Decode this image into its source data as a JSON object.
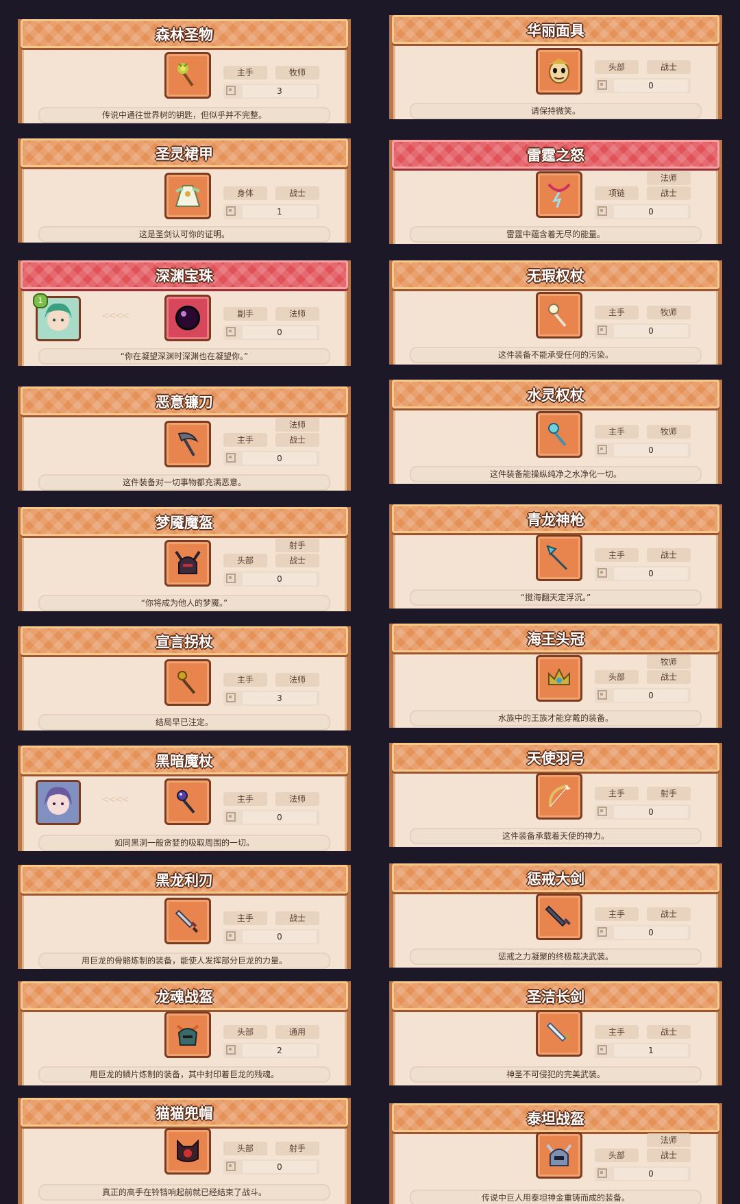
{
  "left": [
    {
      "title": "森林圣物",
      "banner": "orange",
      "icon": "golden-scepter-icon",
      "tags": [
        "主手",
        "牧师"
      ],
      "extra_tag": null,
      "level": "3",
      "desc": "传说中通往世界树的钥匙，但似乎并不完整。"
    },
    {
      "title": "圣灵裙甲",
      "banner": "orange",
      "icon": "holy-dress-icon",
      "tags": [
        "身体",
        "战士"
      ],
      "extra_tag": null,
      "level": "1",
      "desc": "这是圣剑认可你的证明。"
    },
    {
      "title": "深渊宝珠",
      "banner": "red",
      "icon": "abyss-orb-icon",
      "tags": [
        "副手",
        "法师"
      ],
      "extra_tag": null,
      "level": "0",
      "desc": "“你在凝望深渊时深渊也在凝望你。”",
      "portrait": "green-hair-girl-portrait",
      "portrait_badge": "1"
    },
    {
      "title": "恶意镰刀",
      "banner": "orange",
      "icon": "scythe-icon",
      "tags": [
        "主手",
        "战士"
      ],
      "extra_tag": "法师",
      "level": "0",
      "desc": "这件装备对一切事物都充满恶意。"
    },
    {
      "title": "梦魇魔盔",
      "banner": "orange",
      "icon": "horned-helmet-icon",
      "tags": [
        "头部",
        "战士"
      ],
      "extra_tag": "射手",
      "level": "0",
      "desc": "“你将成为他人的梦魇。”"
    },
    {
      "title": "宣言拐杖",
      "banner": "orange",
      "icon": "staff-icon",
      "tags": [
        "主手",
        "法师"
      ],
      "extra_tag": null,
      "level": "3",
      "desc": "结局早已注定。"
    },
    {
      "title": "黑暗魔杖",
      "banner": "orange",
      "icon": "dark-wand-icon",
      "tags": [
        "主手",
        "法师"
      ],
      "extra_tag": null,
      "level": "0",
      "desc": "如同黑洞一般贪婪的吸取周围的一切。",
      "portrait": "purple-hair-girl-portrait"
    },
    {
      "title": "黑龙利刃",
      "banner": "orange",
      "icon": "dragon-blade-icon",
      "tags": [
        "主手",
        "战士"
      ],
      "extra_tag": null,
      "level": "0",
      "desc": "用巨龙的骨骼炼制的装备，能使人发挥部分巨龙的力量。"
    },
    {
      "title": "龙魂战盔",
      "banner": "orange",
      "icon": "dragon-helmet-icon",
      "tags": [
        "头部",
        "通用"
      ],
      "extra_tag": null,
      "level": "2",
      "desc": "用巨龙的鳞片炼制的装备，其中封印着巨龙的残魂。"
    },
    {
      "title": "猫猫兜帽",
      "banner": "orange",
      "icon": "cat-hood-icon",
      "tags": [
        "头部",
        "射手"
      ],
      "extra_tag": null,
      "level": "0",
      "desc": "真正的高手在铃铛响起前就已经结束了战斗。"
    }
  ],
  "right": [
    {
      "title": "华丽面具",
      "banner": "orange",
      "icon": "golden-mask-icon",
      "tags": [
        "头部",
        "战士"
      ],
      "extra_tag": null,
      "level": "0",
      "desc": "请保持微笑。"
    },
    {
      "title": "雷霆之怒",
      "banner": "red",
      "icon": "thunder-necklace-icon",
      "tags": [
        "项链",
        "战士"
      ],
      "extra_tag": "法师",
      "level": "0",
      "desc": "雷霆中蕴含着无尽的能量。"
    },
    {
      "title": "无瑕权杖",
      "banner": "orange",
      "icon": "flawless-scepter-icon",
      "tags": [
        "主手",
        "牧师"
      ],
      "extra_tag": null,
      "level": "0",
      "desc": "这件装备不能承受任何的污染。"
    },
    {
      "title": "水灵权杖",
      "banner": "orange",
      "icon": "water-scepter-icon",
      "tags": [
        "主手",
        "牧师"
      ],
      "extra_tag": null,
      "level": "0",
      "desc": "这件装备能操纵纯净之水净化一切。"
    },
    {
      "title": "青龙神枪",
      "banner": "orange",
      "icon": "spear-icon",
      "tags": [
        "主手",
        "战士"
      ],
      "extra_tag": null,
      "level": "0",
      "desc": "“搅海翻天定浮沉。”"
    },
    {
      "title": "海王头冠",
      "banner": "orange",
      "icon": "crown-icon",
      "tags": [
        "头部",
        "战士"
      ],
      "extra_tag": "牧师",
      "level": "0",
      "desc": "水族中的王族才能穿戴的装备。"
    },
    {
      "title": "天使羽弓",
      "banner": "orange",
      "icon": "angel-bow-icon",
      "tags": [
        "主手",
        "射手"
      ],
      "extra_tag": null,
      "level": "0",
      "desc": "这件装备承载着天使的神力。"
    },
    {
      "title": "惩戒大剑",
      "banner": "orange",
      "icon": "greatsword-icon",
      "tags": [
        "主手",
        "战士"
      ],
      "extra_tag": null,
      "level": "0",
      "desc": "惩戒之力凝聚的终极裁决武装。"
    },
    {
      "title": "圣洁长剑",
      "banner": "orange",
      "icon": "holy-sword-icon",
      "tags": [
        "主手",
        "战士"
      ],
      "extra_tag": null,
      "level": "1",
      "desc": "神圣不可侵犯的完美武装。"
    },
    {
      "title": "泰坦战盔",
      "banner": "orange",
      "icon": "titan-helmet-icon",
      "tags": [
        "头部",
        "战士"
      ],
      "extra_tag": "法师",
      "level": "0",
      "desc": "传说中巨人用泰坦神金重铸而成的装备。"
    }
  ]
}
